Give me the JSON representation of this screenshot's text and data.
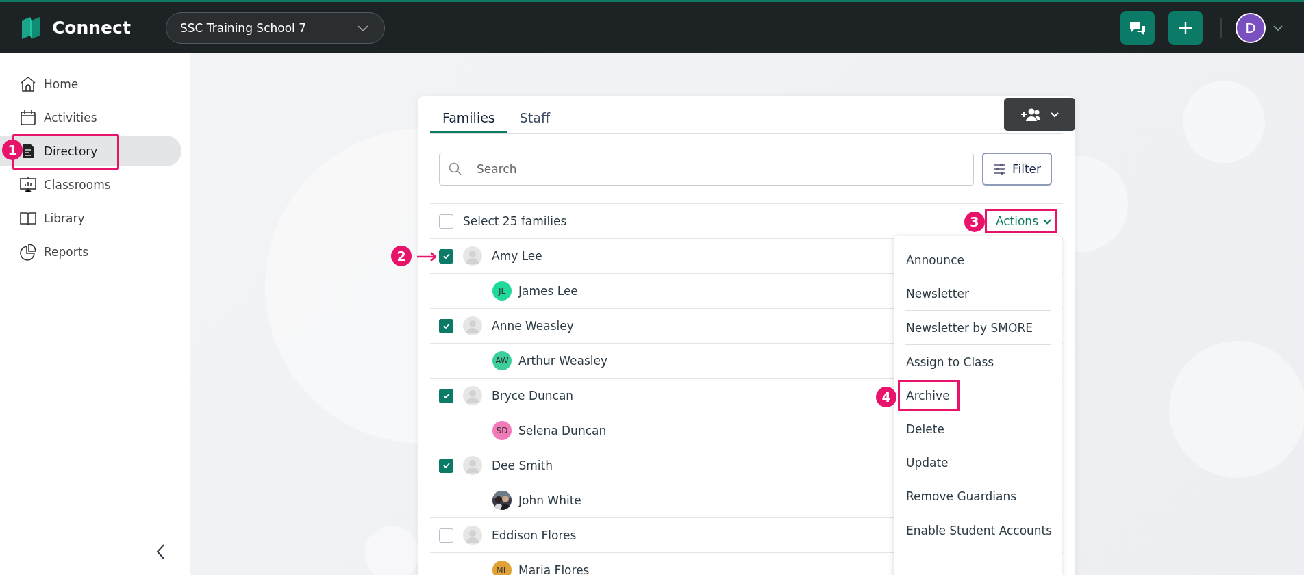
{
  "app": {
    "name": "Connect",
    "school": "SSC Training School 7",
    "user_initial": "D"
  },
  "sidebar": {
    "items": [
      {
        "label": "Home",
        "selected": false
      },
      {
        "label": "Activities",
        "selected": false
      },
      {
        "label": "Directory",
        "selected": true,
        "callout": "1"
      },
      {
        "label": "Classrooms",
        "selected": false
      },
      {
        "label": "Library",
        "selected": false
      },
      {
        "label": "Reports",
        "selected": false
      }
    ]
  },
  "tabs": [
    {
      "label": "Families",
      "selected": true
    },
    {
      "label": "Staff",
      "selected": false
    }
  ],
  "search": {
    "placeholder": "Search"
  },
  "filter_button": "Filter",
  "select_all": {
    "label": "Select 25 families",
    "checked": false
  },
  "actions": {
    "label": "Actions",
    "callout": "3"
  },
  "families": [
    {
      "name": "Amy Lee",
      "checked": true,
      "callout": "2",
      "members": [
        {
          "name": "James Lee",
          "avatar": {
            "kind": "initials",
            "initials": "JL",
            "color": "#1fd99a"
          }
        }
      ]
    },
    {
      "name": "Anne Weasley",
      "checked": true,
      "members": [
        {
          "name": "Arthur Weasley",
          "avatar": {
            "kind": "initials",
            "initials": "AW",
            "color": "#3ccf9c"
          }
        }
      ]
    },
    {
      "name": "Bryce Duncan",
      "checked": true,
      "members": [
        {
          "name": "Selena Duncan",
          "avatar": {
            "kind": "initials",
            "initials": "SD",
            "color": "#f27ab8"
          }
        }
      ]
    },
    {
      "name": "Dee Smith",
      "checked": true,
      "members": [
        {
          "name": "John White"
        }
      ]
    },
    {
      "name": "Eddison Flores",
      "checked": false,
      "members": [
        {
          "name": "Maria Flores",
          "avatar": {
            "kind": "initials",
            "initials": "MF",
            "color": "#e0a236"
          }
        }
      ]
    }
  ],
  "actions_menu": {
    "groups": [
      [
        {
          "label": "Announce"
        },
        {
          "label": "Newsletter"
        }
      ],
      [
        {
          "label": "Newsletter by SMORE"
        }
      ],
      [
        {
          "label": "Assign to Class"
        },
        {
          "label": "Archive",
          "callout": "4"
        },
        {
          "label": "Delete"
        },
        {
          "label": "Update"
        },
        {
          "label": "Remove Guardians"
        }
      ],
      [
        {
          "label": "Enable Student Accounts"
        }
      ]
    ]
  }
}
